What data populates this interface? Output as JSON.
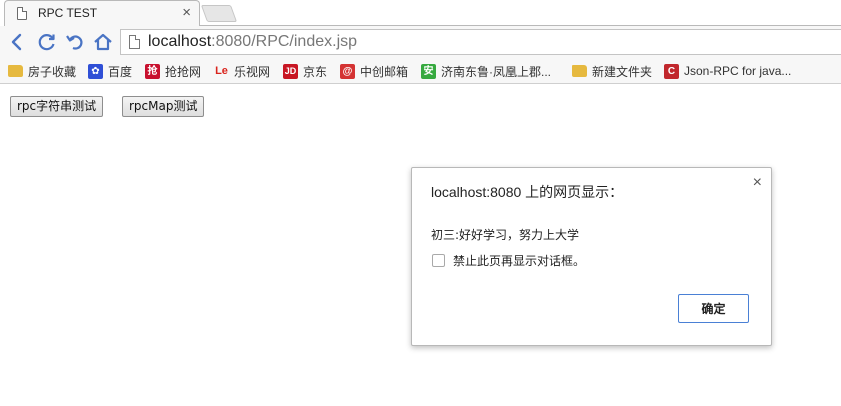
{
  "browser": {
    "tab": {
      "title": "RPC TEST",
      "close_glyph": "×"
    },
    "address": {
      "host": "localhost",
      "path": ":8080/RPC/index.jsp"
    },
    "bookmarks": [
      {
        "label": "房子收藏",
        "icon": "folder-icon",
        "color": "#e6b93f"
      },
      {
        "label": "百度",
        "icon": "baidu-icon",
        "color": "#2f4fd6"
      },
      {
        "label": "抢抢网",
        "icon": "qiangqiang-icon",
        "color": "#c8102e"
      },
      {
        "label": "乐视网",
        "icon": "letv-icon",
        "color": "#d9241d"
      },
      {
        "label": "京东",
        "icon": "jd-icon",
        "color": "#c81623"
      },
      {
        "label": "中创邮箱",
        "icon": "mail-icon",
        "color": "#d43333"
      },
      {
        "label": "济南东鲁·凤凰上郡...",
        "icon": "anjuke-icon",
        "color": "#36a93f"
      },
      {
        "label": "新建文件夹",
        "icon": "folder-icon",
        "color": "#e6b93f"
      },
      {
        "label": "Json-RPC for java...",
        "icon": "csdn-icon",
        "color": "#c1272d"
      }
    ]
  },
  "page": {
    "buttons": [
      {
        "label": "rpc字符串测试"
      },
      {
        "label": "rpcMap测试"
      }
    ]
  },
  "dialog": {
    "title": "localhost:8080 上的网页显示：",
    "close_glyph": "×",
    "message": "初三:好好学习，努力上大学",
    "checkbox_label": "禁止此页再显示对话框。",
    "ok_label": "确定"
  }
}
